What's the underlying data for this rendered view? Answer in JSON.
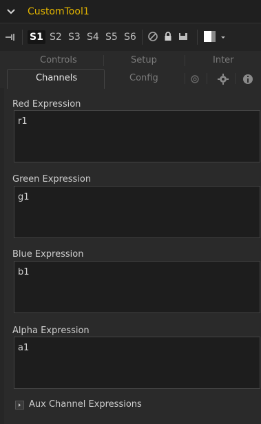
{
  "title": "CustomTool1",
  "toolbar": {
    "slots": [
      "S1",
      "S2",
      "S3",
      "S4",
      "S5",
      "S6"
    ],
    "active_slot": "S1"
  },
  "tabs_row1": [
    "Controls",
    "Setup",
    "Inter"
  ],
  "tabs_row2": [
    "Channels",
    "Config"
  ],
  "active_tab": "Channels",
  "fields": [
    {
      "label": "Red Expression",
      "value": "r1"
    },
    {
      "label": "Green Expression",
      "value": "g1"
    },
    {
      "label": "Blue Expression",
      "value": "b1"
    },
    {
      "label": "Alpha Expression",
      "value": "a1"
    }
  ],
  "aux_label": "Aux Channel Expressions",
  "colors": {
    "title": "#e2b400",
    "background": "#2a2a2a",
    "field_bg": "#1d1d1d"
  }
}
